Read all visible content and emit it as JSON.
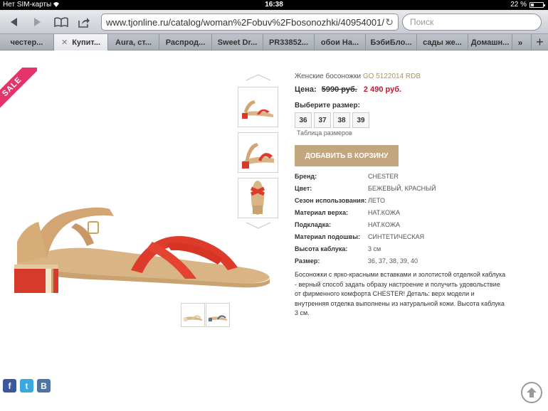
{
  "status": {
    "carrier": "Нет SIM-карты",
    "time": "16:38",
    "battery": "22 %",
    "battery_level": 0.22
  },
  "toolbar": {
    "url": "www.tjonline.ru/catalog/woman%2Fobuv%2Fbosonozhki/40954001/",
    "search_placeholder": "Поиск"
  },
  "tabs": [
    {
      "label": "честер..."
    },
    {
      "label": "Купит..."
    },
    {
      "label": "Aura, ст..."
    },
    {
      "label": "Распрод..."
    },
    {
      "label": "Sweet Dr..."
    },
    {
      "label": "PR33852..."
    },
    {
      "label": "обои На..."
    },
    {
      "label": "БэбиБло..."
    },
    {
      "label": "сады же..."
    },
    {
      "label": "Домашн..."
    }
  ],
  "product": {
    "sale_badge": "SALE",
    "title": "Женские босоножки",
    "code": "GO 5122014 RDB",
    "price_label": "Цена:",
    "old_price": "5990 руб.",
    "new_price": "2 490 руб.",
    "size_label": "Выберите размер:",
    "sizes": [
      "36",
      "37",
      "38",
      "39"
    ],
    "size_table": "Таблица размеров",
    "cart_button": "ДОБАВИТЬ В КОРЗИНУ",
    "specs": [
      {
        "k": "Бренд:",
        "v": "CHESTER"
      },
      {
        "k": "Цвет:",
        "v": "БЕЖЕВЫЙ, КРАСНЫЙ"
      },
      {
        "k": "Сезон использования:",
        "v": "ЛЕТО"
      },
      {
        "k": "Материал верха:",
        "v": "НАТ.КОЖА"
      },
      {
        "k": "Подкладка:",
        "v": "НАТ.КОЖА"
      },
      {
        "k": "Материал подошвы:",
        "v": "СИНТЕТИЧЕСКАЯ"
      },
      {
        "k": "Высота каблука:",
        "v": "3 см"
      },
      {
        "k": "Размер:",
        "v": "36, 37, 38, 39, 40"
      }
    ],
    "description": "Босоножки с ярко-красными вставками и золотистой отделкой каблука - верный способ задать образу настроение и получить удовольствие от фирменного комфорта CHESTER! Деталь: верх модели и внутренняя отделка выполнены из натуральной кожи. Высота каблука 3 см."
  },
  "social": {
    "facebook": "f",
    "twitter": "t",
    "vk": "B"
  },
  "colors": {
    "accent": "#c2a67e",
    "price": "#c0182e",
    "sale": "#e4356a"
  }
}
